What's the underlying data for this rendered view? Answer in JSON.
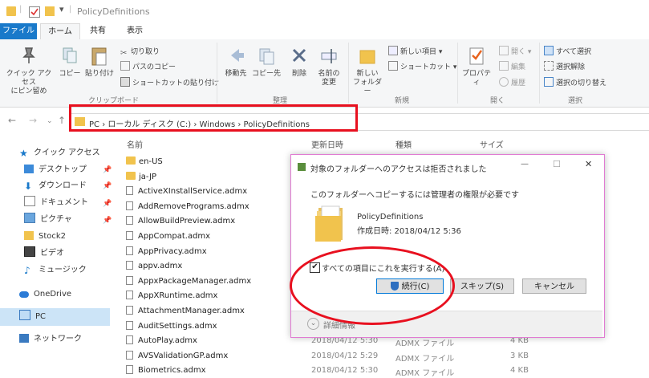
{
  "window": {
    "title": "PolicyDefinitions"
  },
  "tabs": {
    "file": "ファイル",
    "home": "ホーム",
    "share": "共有",
    "view": "表示"
  },
  "ribbon": {
    "pin": "クイック アクセス\nにピン留め",
    "copy": "コピー",
    "paste": "貼り付け",
    "cut": "切り取り",
    "copy_path": "パスのコピー",
    "paste_shortcut": "ショートカットの貼り付け",
    "move_to": "移動先",
    "copy_to": "コピー先",
    "delete": "削除",
    "rename": "名前の\n変更",
    "new_folder": "新しい\nフォルダー",
    "new_item": "新しい項目",
    "shortcut": "ショートカット",
    "properties": "プロパティ",
    "open": "開く",
    "edit": "編集",
    "history": "履歴",
    "select_all": "すべて選択",
    "select_none": "選択解除",
    "invert_selection": "選択の切り替え",
    "group_clipboard": "クリップボード",
    "group_organize": "整理",
    "group_new": "新規",
    "group_open": "開く",
    "group_select": "選択"
  },
  "address": {
    "path": "PC  ›  ローカル ディスク (C:)  ›  Windows  ›  PolicyDefinitions"
  },
  "columns": {
    "name": "名前",
    "date": "更新日時",
    "type": "種類",
    "size": "サイズ"
  },
  "nav": {
    "quick_access": "クイック アクセス",
    "desktop": "デスクトップ",
    "downloads": "ダウンロード",
    "documents": "ドキュメント",
    "pictures": "ピクチャ",
    "stock2": "Stock2",
    "videos": "ビデオ",
    "music": "ミュージック",
    "onedrive": "OneDrive",
    "pc": "PC",
    "network": "ネットワーク"
  },
  "files": [
    {
      "name": "en-US",
      "folder": true
    },
    {
      "name": "ja-JP",
      "folder": true
    },
    {
      "name": "ActiveXInstallService.admx"
    },
    {
      "name": "AddRemovePrograms.admx"
    },
    {
      "name": "AllowBuildPreview.admx"
    },
    {
      "name": "AppCompat.admx"
    },
    {
      "name": "AppPrivacy.admx"
    },
    {
      "name": "appv.admx"
    },
    {
      "name": "AppxPackageManager.admx"
    },
    {
      "name": "AppXRuntime.admx"
    },
    {
      "name": "AttachmentManager.admx"
    },
    {
      "name": "AuditSettings.admx"
    },
    {
      "name": "AutoPlay.admx",
      "date": "2018/04/12 5:30",
      "type": "ADMX ファイル",
      "size": "4 KB"
    },
    {
      "name": "AVSValidationGP.admx",
      "date": "2018/04/12 5:29",
      "type": "ADMX ファイル",
      "size": "3 KB"
    },
    {
      "name": "Biometrics.admx",
      "date": "2018/04/12 5:30",
      "type": "ADMX ファイル",
      "size": "4 KB"
    }
  ],
  "dialog": {
    "title": "対象のフォルダーへのアクセスは拒否されました",
    "message": "このフォルダーへコピーするには管理者の権限が必要です",
    "folder_name": "PolicyDefinitions",
    "created": "作成日時: 2018/04/12 5:36",
    "checkbox_label": "すべての項目にこれを実行する(A)",
    "checkbox_checked": true,
    "continue": "続行(C)",
    "skip": "スキップ(S)",
    "cancel": "キャンセル",
    "details": "詳細情報",
    "minimize": "—",
    "maximize": "☐",
    "close": "✕"
  },
  "colors": {
    "accent": "#1979ca",
    "highlight_red": "#e8101f",
    "selection": "#cce4f7"
  }
}
